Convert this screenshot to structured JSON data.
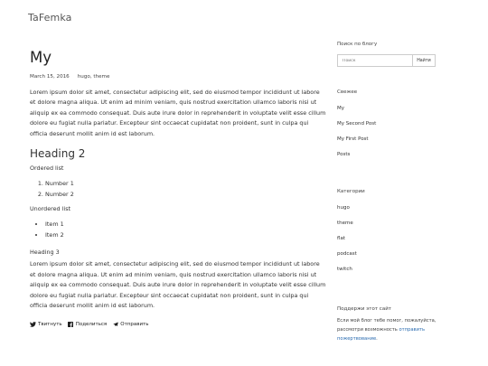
{
  "site": {
    "title": "TaFemka"
  },
  "post": {
    "title": "My",
    "date": "March 15, 2016",
    "tags": "hugo, theme",
    "paragraph1": "Lorem ipsum dolor sit amet, consectetur adipiscing elit, sed do eiusmod tempor incididunt ut labore et dolore magna aliqua. Ut enim ad minim veniam, quis nostrud exercitation ullamco laboris nisi ut aliquip ex ea commodo consequat. Duis aute irure dolor in reprehenderit in voluptate velit esse cillum dolore eu fugiat nulla pariatur. Excepteur sint occaecat cupidatat non proident, sunt in culpa qui officia deserunt mollit anim id est laborum.",
    "heading2": "Heading 2",
    "ordered_label": "Ordered list",
    "ordered_items": [
      "Number 1",
      "Number 2"
    ],
    "unordered_label": "Unordered list",
    "unordered_items": [
      "Item 1",
      "Item 2"
    ],
    "heading3": "Heading 3",
    "paragraph2": "Lorem ipsum dolor sit amet, consectetur adipiscing elit, sed do eiusmod tempor incididunt ut labore et dolore magna aliqua. Ut enim ad minim veniam, quis nostrud exercitation ullamco laboris nisi ut aliquip ex ea commodo consequat. Duis aute irure dolor in reprehenderit in voluptate velit esse cillum dolore eu fugiat nulla pariatur. Excepteur sint occaecat cupidatat non proident, sunt in culpa qui officia deserunt mollit anim id est laborum."
  },
  "share": {
    "twitter": "Твитнуть",
    "facebook": "Поделиться",
    "telegram": "Отправить"
  },
  "sidebar": {
    "search": {
      "heading": "Поиск по блогу",
      "placeholder": "Поиск",
      "button": "Найти"
    },
    "recent": {
      "heading": "Свежее",
      "items": [
        "My",
        "My Second Post",
        "My First Post",
        "Posts"
      ]
    },
    "categories": {
      "heading": "Категории",
      "items": [
        "hugo",
        "theme",
        "flat",
        "podcast",
        "twitch"
      ]
    },
    "support": {
      "heading": "Поддержи этот сайт",
      "text": "Если мой блог тебе помог, пожалуйста, рассмотри возможность ",
      "link": "отправить пожертвование",
      "end": "."
    }
  },
  "colors": {
    "link": "#2b6cb0",
    "text": "#333333",
    "border": "#cccccc"
  }
}
